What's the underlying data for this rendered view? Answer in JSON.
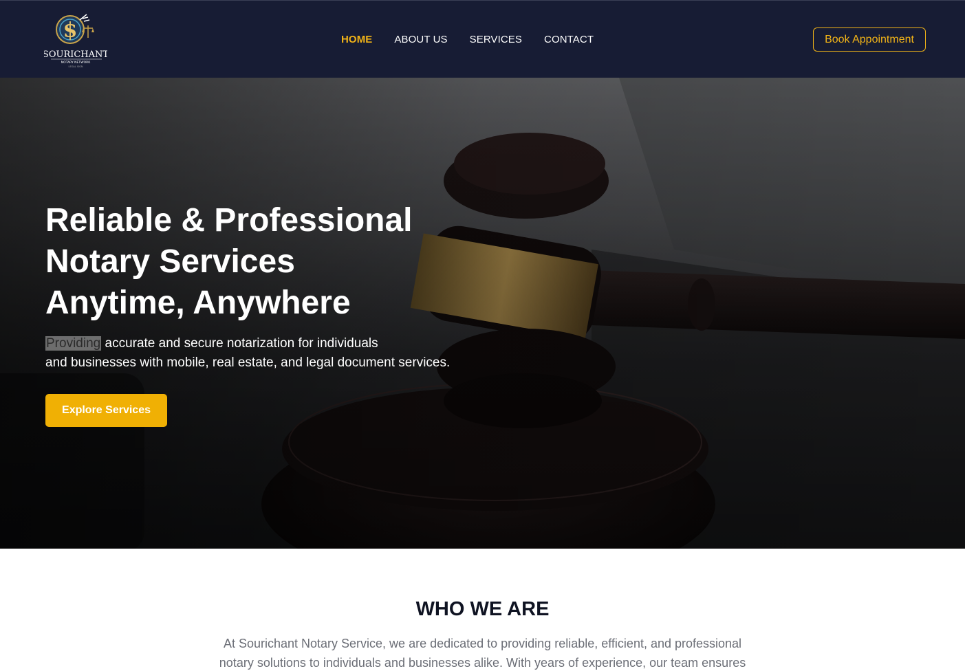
{
  "header": {
    "logo": {
      "brand_name": "SOURICHANT",
      "tagline": "NOTARY NETWORK",
      "small_text": "LEGAL SIGN",
      "icon": "dollar-scales-seal-icon"
    },
    "nav": [
      {
        "label": "HOME",
        "active": true
      },
      {
        "label": "ABOUT US",
        "active": false
      },
      {
        "label": "SERVICES",
        "active": false
      },
      {
        "label": "CONTACT",
        "active": false
      }
    ],
    "cta_label": "Book Appointment"
  },
  "hero": {
    "title_lines": [
      "Reliable & Professional",
      "Notary Services",
      "Anytime, Anywhere"
    ],
    "subtitle_highlight": "Providing",
    "subtitle_line1_rest": " accurate and secure notarization for individuals",
    "subtitle_line2": "and businesses with mobile, real estate, and legal document services.",
    "button_label": "Explore Services",
    "background_image": "gavel-photo"
  },
  "who": {
    "title": "WHO WE ARE",
    "lines": [
      "At Sourichant Notary Service, we are dedicated to providing reliable, efficient, and professional",
      "notary solutions to individuals and businesses alike. With years of experience, our team ensures"
    ]
  },
  "colors": {
    "header_bg": "#171c34",
    "accent": "#f2b417",
    "button_bg": "#f0b004"
  }
}
